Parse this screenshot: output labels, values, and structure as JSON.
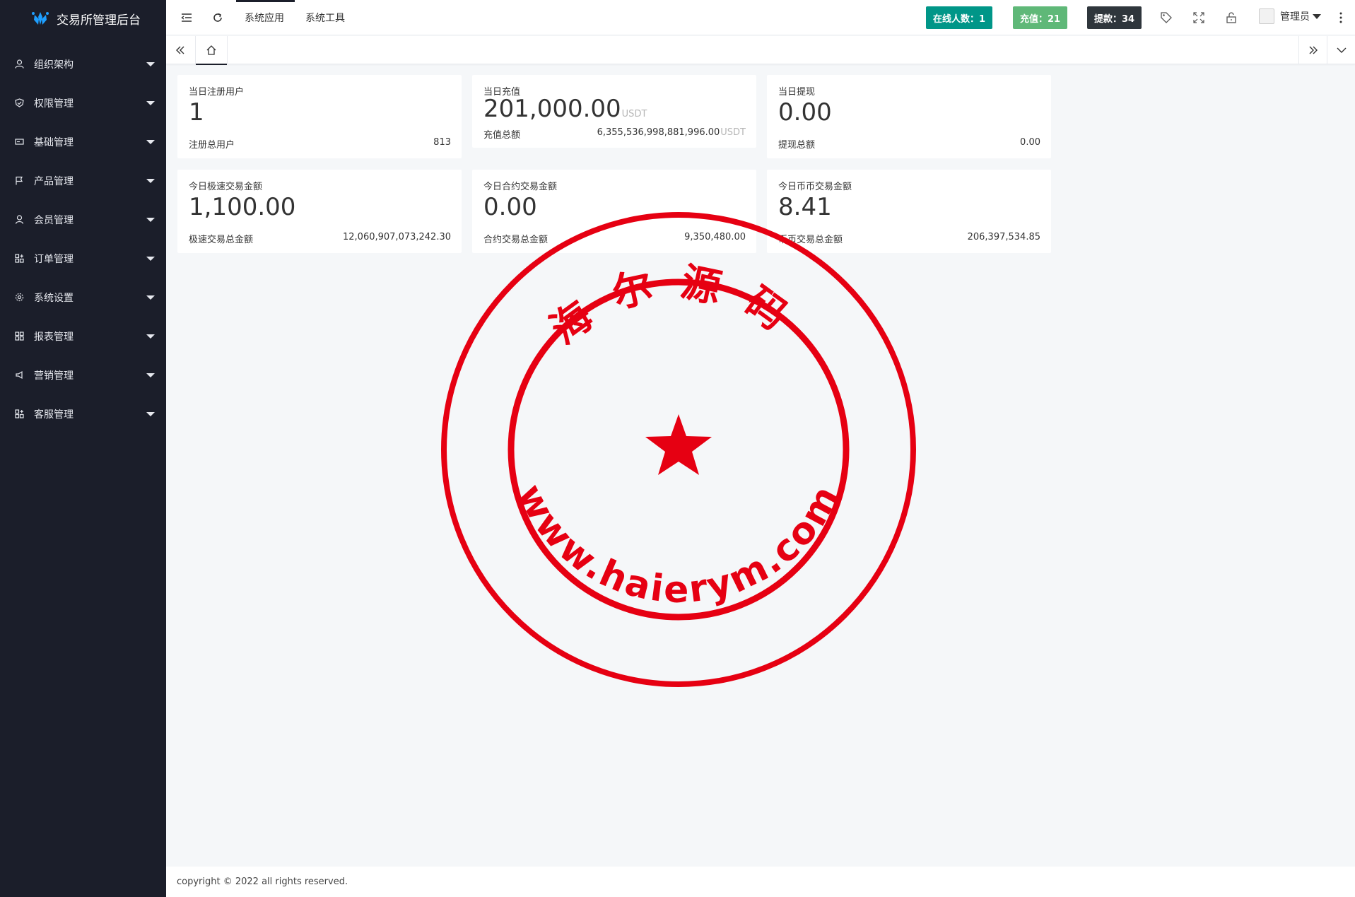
{
  "app": {
    "title": "交易所管理后台"
  },
  "sidebar": {
    "items": [
      {
        "label": "组织架构",
        "icon": "user-icon"
      },
      {
        "label": "权限管理",
        "icon": "shield-icon"
      },
      {
        "label": "基础管理",
        "icon": "card-icon"
      },
      {
        "label": "产品管理",
        "icon": "flag-icon"
      },
      {
        "label": "会员管理",
        "icon": "person-icon"
      },
      {
        "label": "订单管理",
        "icon": "grid-plus-icon"
      },
      {
        "label": "系统设置",
        "icon": "gear-icon"
      },
      {
        "label": "报表管理",
        "icon": "report-grid-icon"
      },
      {
        "label": "营销管理",
        "icon": "megaphone-icon"
      },
      {
        "label": "客服管理",
        "icon": "grid-plus-icon"
      }
    ]
  },
  "header": {
    "tabs": [
      {
        "label": "系统应用",
        "active": true
      },
      {
        "label": "系统工具",
        "active": false
      }
    ],
    "badges": {
      "online": {
        "label": "在线人数：1",
        "color": "#009688"
      },
      "recharge": {
        "label": "充值：21",
        "color": "#5fb878"
      },
      "withdraw": {
        "label": "提款：34",
        "color": "#2f363c"
      }
    },
    "user": {
      "name": "管理员"
    }
  },
  "cards": [
    {
      "title": "当日注册用户",
      "value": "1",
      "unit": "",
      "foot_label": "注册总用户",
      "foot_value": "813",
      "foot_unit": ""
    },
    {
      "title": "当日充值",
      "value": "201,000.00",
      "unit": "USDT",
      "foot_label": "充值总额",
      "foot_value": "6,355,536,998,881,996.00",
      "foot_unit": "USDT"
    },
    {
      "title": "当日提现",
      "value": "0.00",
      "unit": "",
      "foot_label": "提现总额",
      "foot_value": "0.00",
      "foot_unit": ""
    },
    {
      "title": "今日极速交易金额",
      "value": "1,100.00",
      "unit": "",
      "foot_label": "极速交易总金额",
      "foot_value": "12,060,907,073,242.30",
      "foot_unit": ""
    },
    {
      "title": "今日合约交易金额",
      "value": "0.00",
      "unit": "",
      "foot_label": "合约交易总金额",
      "foot_value": "9,350,480.00",
      "foot_unit": ""
    },
    {
      "title": "今日币币交易金额",
      "value": "8.41",
      "unit": "",
      "foot_label": "币币交易总金额",
      "foot_value": "206,397,534.85",
      "foot_unit": ""
    }
  ],
  "footer": {
    "text": "copyright © 2022 all rights reserved."
  },
  "watermark": {
    "top_text": "海尔源码",
    "bottom_text": "www.haierym.com",
    "color": "#e60012"
  }
}
